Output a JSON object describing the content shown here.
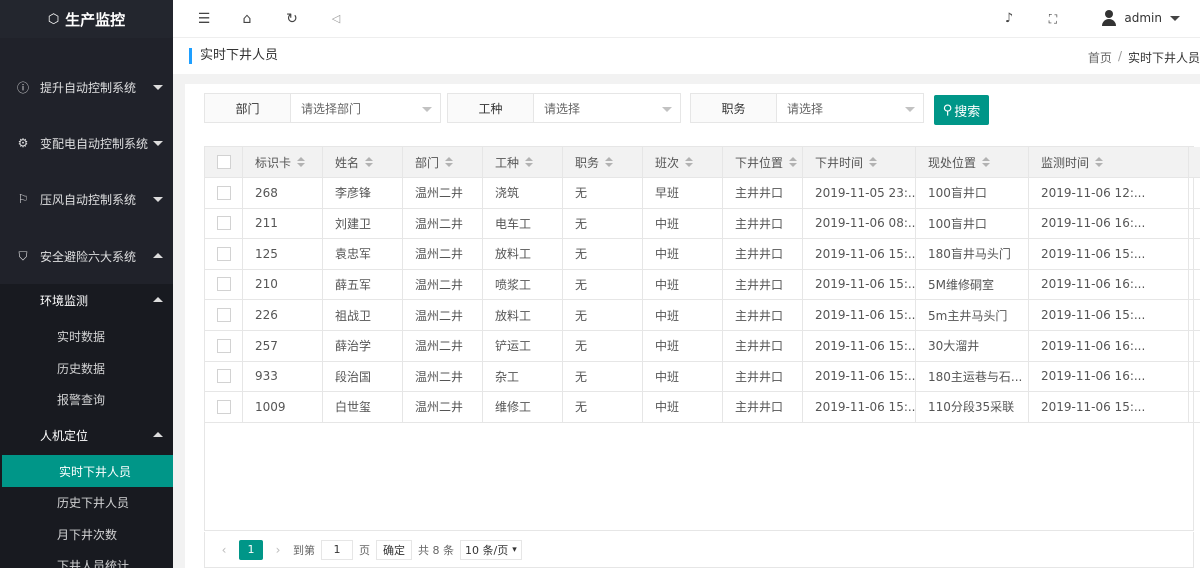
{
  "app": {
    "title": "生产监控"
  },
  "sidebar": {
    "groups": [
      {
        "label": "提升自动控制系统",
        "icon": "info-circle-icon",
        "glyph": "ⓘ"
      },
      {
        "label": "变配电自动控制系统",
        "icon": "gear-icon",
        "glyph": "⚙"
      },
      {
        "label": "压风自动控制系统",
        "icon": "flag-icon",
        "glyph": "⚐"
      },
      {
        "label": "安全避险六大系统",
        "icon": "shield-icon",
        "glyph": "⛉"
      }
    ],
    "env": {
      "label": "环境监测",
      "items": [
        "实时数据",
        "历史数据",
        "报警查询"
      ]
    },
    "position": {
      "label": "人机定位",
      "items": [
        "实时下井人员",
        "历史下井人员",
        "月下井次数",
        "下井人员统计"
      ]
    }
  },
  "topbar": {
    "user": "admin"
  },
  "breadcrumb": {
    "title": "实时下井人员",
    "home": "首页",
    "sep": "/",
    "current": "实时下井人员"
  },
  "filters": {
    "dept": {
      "label": "部门",
      "placeholder": "请选择部门"
    },
    "worktype": {
      "label": "工种",
      "placeholder": "请选择"
    },
    "position": {
      "label": "职务",
      "placeholder": "请选择"
    },
    "search": "搜索"
  },
  "table": {
    "headers": [
      "标识卡",
      "姓名",
      "部门",
      "工种",
      "职务",
      "班次",
      "下井位置",
      "下井时间",
      "现处位置",
      "监测时间"
    ],
    "rows": [
      [
        "268",
        "李彦锋",
        "温州二井",
        "浇筑",
        "无",
        "早班",
        "主井井口",
        "2019-11-05 23:...",
        "100盲井口",
        "2019-11-06 12:..."
      ],
      [
        "211",
        "刘建卫",
        "温州二井",
        "电车工",
        "无",
        "中班",
        "主井井口",
        "2019-11-06 08:...",
        "100盲井口",
        "2019-11-06 16:..."
      ],
      [
        "125",
        "袁忠军",
        "温州二井",
        "放料工",
        "无",
        "中班",
        "主井井口",
        "2019-11-06 15:...",
        "180盲井马头门",
        "2019-11-06 15:..."
      ],
      [
        "210",
        "薛五军",
        "温州二井",
        "喷浆工",
        "无",
        "中班",
        "主井井口",
        "2019-11-06 15:...",
        "5M维修硐室",
        "2019-11-06 16:..."
      ],
      [
        "226",
        "祖战卫",
        "温州二井",
        "放料工",
        "无",
        "中班",
        "主井井口",
        "2019-11-06 15:...",
        "5m主井马头门",
        "2019-11-06 15:..."
      ],
      [
        "257",
        "薛治学",
        "温州二井",
        "铲运工",
        "无",
        "中班",
        "主井井口",
        "2019-11-06 15:...",
        "30大溜井",
        "2019-11-06 16:..."
      ],
      [
        "933",
        "段治国",
        "温州二井",
        "杂工",
        "无",
        "中班",
        "主井井口",
        "2019-11-06 15:...",
        "180主运巷与石...",
        "2019-11-06 16:..."
      ],
      [
        "1009",
        "白世玺",
        "温州二井",
        "维修工",
        "无",
        "中班",
        "主井井口",
        "2019-11-06 15:...",
        "110分段35采联",
        "2019-11-06 15:..."
      ]
    ]
  },
  "pager": {
    "current": "1",
    "goto_label": "到第",
    "page_value": "1",
    "page_unit": "页",
    "confirm": "确定",
    "total": "共 8 条",
    "page_size": "10 条/页"
  },
  "colors": {
    "accent": "#009688",
    "sidebar": "#20222a",
    "title_bar": "#1e9fff"
  }
}
